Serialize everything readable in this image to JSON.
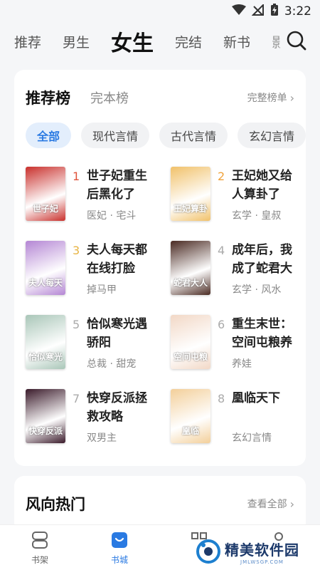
{
  "status_bar": {
    "time": "3:22"
  },
  "top_tabs": [
    "推荐",
    "男生",
    "女生",
    "完结",
    "新书",
    "影"
  ],
  "active_tab_index": 2,
  "ranking": {
    "title": "推荐榜",
    "subtab": "完本榜",
    "more": "完整榜单",
    "chips": [
      "全部",
      "现代言情",
      "古代言情",
      "玄幻言情"
    ],
    "books": [
      {
        "rank": "1",
        "title": "世子妃重生后黑化了",
        "meta": "医妃 · 宅斗",
        "cover_text": "世子妃",
        "cover_color": "#c9302c"
      },
      {
        "rank": "2",
        "title": "王妃她又给人算卦了",
        "meta": "玄学 · 皇叔",
        "cover_text": "王妃算卦",
        "cover_color": "#f1c16a"
      },
      {
        "rank": "3",
        "title": "夫人每天都在线打脸",
        "meta": "掉马甲",
        "cover_text": "夫人每天",
        "cover_color": "#b486d4"
      },
      {
        "rank": "4",
        "title": "成年后，我成了蛇君大",
        "meta": "玄学 · 风水",
        "cover_text": "蛇君大人",
        "cover_color": "#4a2a22"
      },
      {
        "rank": "5",
        "title": "恰似寒光遇骄阳",
        "meta": "总裁 · 甜宠",
        "cover_text": "恰似寒光",
        "cover_color": "#a9c6b8"
      },
      {
        "rank": "6",
        "title": "重生末世：空间屯粮养",
        "meta": "养娃",
        "cover_text": "空间屯粮",
        "cover_color": "#f2d8c6"
      },
      {
        "rank": "7",
        "title": "快穿反派拯救攻略",
        "meta": "双男主",
        "cover_text": "快穿反派",
        "cover_color": "#3a1a2a"
      },
      {
        "rank": "8",
        "title": "凰临天下",
        "meta": "玄幻言情",
        "cover_text": "凰临",
        "cover_color": "#f3cf9a"
      }
    ]
  },
  "hot": {
    "title": "风向热门",
    "more": "查看全部"
  },
  "bottom_nav": [
    {
      "label": "书架",
      "icon": "bookshelf-icon"
    },
    {
      "label": "书城",
      "icon": "bookstore-icon"
    },
    {
      "label": "",
      "icon": "category-icon"
    },
    {
      "label": "",
      "icon": "profile-icon"
    }
  ],
  "watermark": {
    "main": "精美软件园",
    "sub": "JMLWSGP.COM"
  },
  "colors": {
    "accent": "#2a7ae2",
    "rank_top": "#e0543c"
  }
}
